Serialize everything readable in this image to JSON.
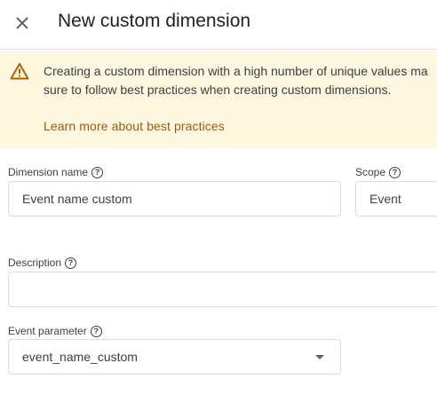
{
  "header": {
    "title": "New custom dimension",
    "close_icon": "close-icon"
  },
  "banner": {
    "icon": "warning-icon",
    "line1": "Creating a custom dimension with a high number of unique values ma",
    "line2": "sure to follow best practices when creating custom dimensions.",
    "link": "Learn more about best practices",
    "colors": {
      "background": "#fef7e0",
      "icon": "#b06000",
      "link": "#9a5b13"
    }
  },
  "form": {
    "dimension_name": {
      "label": "Dimension name",
      "value": "Event name custom"
    },
    "scope": {
      "label": "Scope",
      "value": "Event"
    },
    "description": {
      "label": "Description",
      "value": ""
    },
    "event_parameter": {
      "label": "Event parameter",
      "value": "event_name_custom"
    },
    "help_glyph": "?"
  }
}
